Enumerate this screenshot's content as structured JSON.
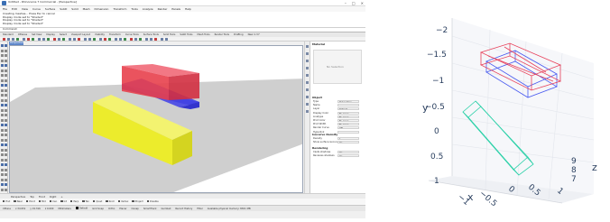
{
  "app": {
    "title": "Untitled - Rhinoceros 7 Commercial - [Perspective]",
    "window_controls": [
      "–",
      "□",
      "×"
    ]
  },
  "menu": [
    "File",
    "Edit",
    "View",
    "Curve",
    "Surface",
    "SubD",
    "Solid",
    "Mesh",
    "Dimension",
    "Transform",
    "Tools",
    "Analyze",
    "Render",
    "Panels",
    "Help"
  ],
  "command_history": [
    "Creating meshes... Press Esc to cancel",
    "Display mode set to \"Shaded\"",
    "Display mode set to \"Shaded\"",
    "Display mode set to \"Shaded\""
  ],
  "command_prompt": "Command:",
  "toolbar_tabs": [
    "Standard",
    "CPlanes",
    "Set View",
    "Display",
    "Select",
    "Viewport Layout",
    "Visibility",
    "Transform",
    "Curve Tools",
    "Surface Tools",
    "Solid Tools",
    "SubD Tools",
    "Mesh Tools",
    "Render Tools",
    "Drafting",
    "New in V7"
  ],
  "viewport": {
    "tab_label": "Perspective",
    "colors": {
      "ground": "#cfcfcf",
      "red": "#e8404c",
      "blue": "#3f3fe0",
      "yellow": "#ecec2c"
    }
  },
  "panel": {
    "header_label": "Material",
    "preview_label": "No Selection",
    "section_object": "Object",
    "props": [
      {
        "label": "Type",
        "value": "Polysurface"
      },
      {
        "label": "Name",
        "value": ""
      },
      {
        "label": "Layer",
        "value": "Default"
      },
      {
        "label": "Display Color",
        "value": "By Layer"
      },
      {
        "label": "Linetype",
        "value": "By Layer"
      },
      {
        "label": "Print Color",
        "value": "By Layer"
      },
      {
        "label": "Print Width",
        "value": "By Layer"
      },
      {
        "label": "Render Curve",
        "value": "Off"
      },
      {
        "label": "Hyperlink",
        "value": ""
      }
    ],
    "section_isocurve": "Isocurve Density",
    "density_props": [
      {
        "label": "Density",
        "value": "1"
      },
      {
        "label": "Show surface isocurves",
        "value": "On"
      }
    ],
    "section_rendering": "Rendering",
    "render_props": [
      {
        "label": "Casts shadows",
        "value": "On"
      },
      {
        "label": "Receives shadows",
        "value": "On"
      }
    ]
  },
  "bottom_tabs": [
    "Perspective",
    "Top",
    "Front",
    "Right",
    "+"
  ],
  "osnaps": [
    "End",
    "Near",
    "Point",
    "Mid",
    "Cen",
    "Int",
    "Perp",
    "Tan",
    "Quad",
    "Knot",
    "Vertex",
    "Project",
    "Disable"
  ],
  "statusbar": {
    "cplane": "CPlane",
    "x": "x 34.951",
    "y": "y 19.316",
    "z": "z 0.000",
    "units": "Millimeters",
    "layer": "Default",
    "items": [
      "Grid Snap",
      "Ortho",
      "Planar",
      "Osnap",
      "SmartTrack",
      "Gumball",
      "Record History",
      "Filter"
    ],
    "memory": "Available physical memory: 8301 MB"
  },
  "plot3d": {
    "axis_x_title": "x",
    "axis_y_title": "y",
    "axis_z_title": "z",
    "y_ticks": [
      "−2",
      "−1.5",
      "−1",
      "−0.5",
      "0",
      "0.5",
      "1"
    ],
    "x_ticks": [
      "−1",
      "−0.5",
      "0",
      "0.5",
      "1"
    ],
    "z_ticks": [
      "9",
      "8",
      "7"
    ],
    "colors": {
      "red": "#e8405a",
      "blue": "#4a5cf0",
      "teal": "#2bd1a8"
    }
  }
}
